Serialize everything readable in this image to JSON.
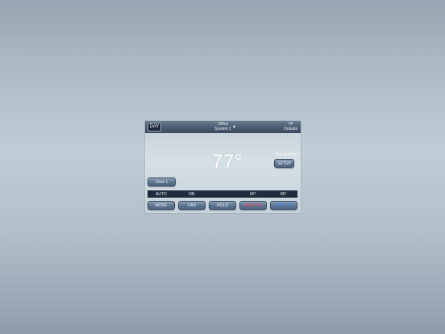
{
  "header": {
    "day_label": "DAY",
    "location": "Office",
    "system": "System 1",
    "outside_temp": "74°",
    "outside_label": "Outside"
  },
  "display": {
    "temperature": "77°",
    "humidity": "34% Humidity"
  },
  "buttons": {
    "setup": "SETUP",
    "zone": "Zone 1",
    "mode": "MODE",
    "fan": "FAN",
    "hold": "HOLD",
    "heat_to": "HEAT TO",
    "cool_to": "COOL TO"
  },
  "status": {
    "mode": "AUTO",
    "fan": "ON",
    "heat_setpoint": "60°",
    "cool_setpoint": "85°"
  },
  "colors": {
    "heat": "#ff3b5c",
    "cool": "#3d7cff"
  }
}
